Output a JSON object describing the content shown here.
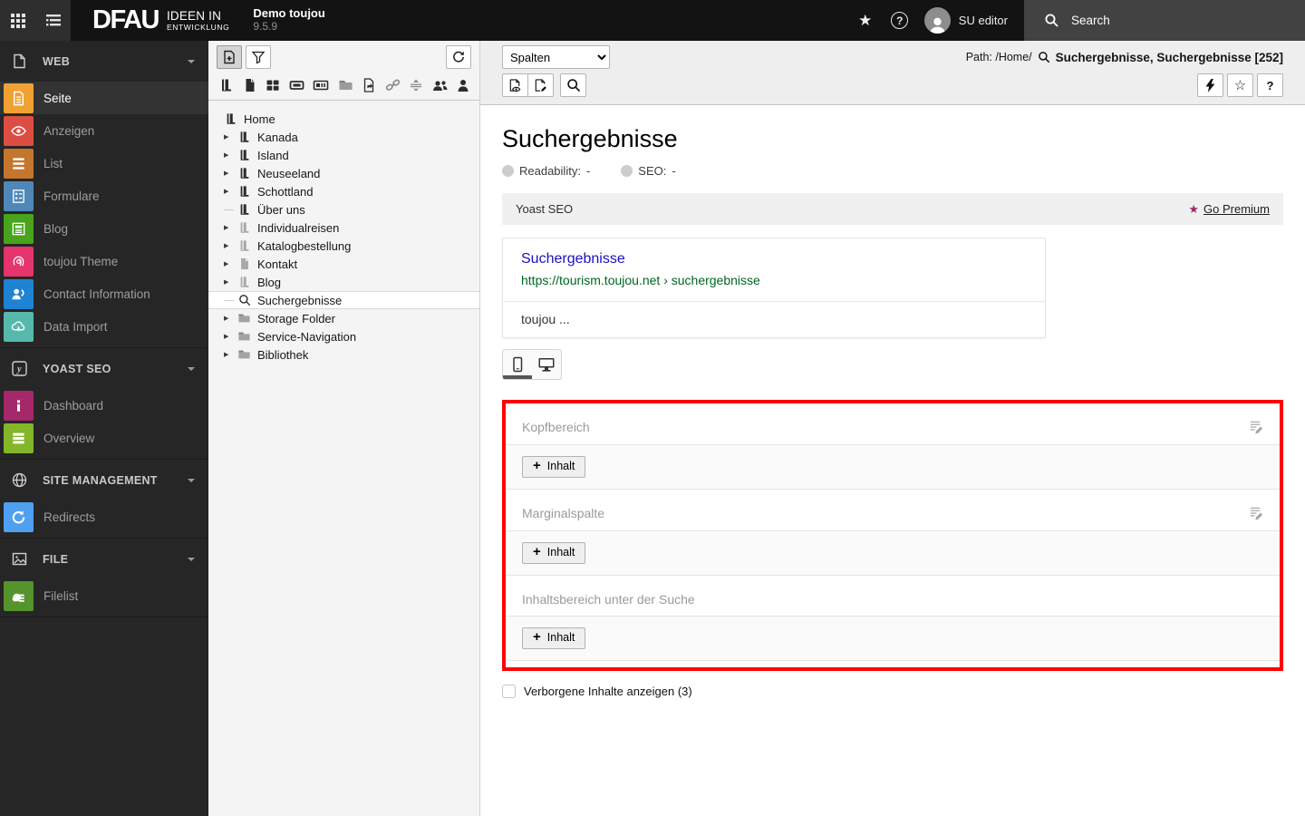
{
  "topbar": {
    "brand": "DFAU",
    "claim_line1": "IDEEN IN",
    "claim_line2": "ENTWICKLUNG",
    "site_name": "Demo toujou",
    "version": "9.5.9",
    "username": "SU editor",
    "search_label": "Search"
  },
  "module_menu": {
    "sections": [
      {
        "label": "WEB",
        "icon": "web-section-icon",
        "items": [
          {
            "label": "Seite",
            "icon": "page-icon",
            "color": "#f0a132"
          },
          {
            "label": "Anzeigen",
            "icon": "eye-icon",
            "color": "#dc4e41"
          },
          {
            "label": "List",
            "icon": "list-icon",
            "color": "#c4762c"
          },
          {
            "label": "Formulare",
            "icon": "form-icon",
            "color": "#4f87b8"
          },
          {
            "label": "Blog",
            "icon": "blog-icon",
            "color": "#48a41c"
          },
          {
            "label": "toujou Theme",
            "icon": "fingerprint-icon",
            "color": "#e5346c"
          },
          {
            "label": "Contact Information",
            "icon": "contact-icon",
            "color": "#1f83d3"
          },
          {
            "label": "Data Import",
            "icon": "cloud-import-icon",
            "color": "#57b9ac"
          }
        ]
      },
      {
        "label": "YOAST SEO",
        "icon": "yoast-section-icon",
        "items": [
          {
            "label": "Dashboard",
            "icon": "info-icon",
            "color": "#a4286a"
          },
          {
            "label": "Overview",
            "icon": "bars-icon",
            "color": "#84b62a"
          }
        ]
      },
      {
        "label": "SITE MANAGEMENT",
        "icon": "globe-section-icon",
        "items": [
          {
            "label": "Redirects",
            "icon": "redirect-icon",
            "color": "#4fa0f0"
          }
        ]
      },
      {
        "label": "FILE",
        "icon": "image-section-icon",
        "items": [
          {
            "label": "Filelist",
            "icon": "filelist-icon",
            "color": "#55932c"
          }
        ]
      }
    ]
  },
  "pagetree": {
    "items": [
      {
        "label": "Home",
        "icon": "page-door-icon"
      },
      {
        "label": "Kanada",
        "icon": "page-door-icon"
      },
      {
        "label": "Island",
        "icon": "page-door-icon"
      },
      {
        "label": "Neuseeland",
        "icon": "page-door-icon"
      },
      {
        "label": "Schottland",
        "icon": "page-door-icon"
      },
      {
        "label": "Über uns",
        "icon": "page-door-icon"
      },
      {
        "label": "Individualreisen",
        "icon": "page-door-muted-icon"
      },
      {
        "label": "Katalogbestellung",
        "icon": "page-door-muted-icon"
      },
      {
        "label": "Kontakt",
        "icon": "page-muted-icon"
      },
      {
        "label": "Blog",
        "icon": "page-door-muted-icon"
      },
      {
        "label": "Suchergebnisse",
        "icon": "search-page-icon",
        "selected": true
      },
      {
        "label": "Storage Folder",
        "icon": "folder-icon"
      },
      {
        "label": "Service-Navigation",
        "icon": "folder-icon"
      },
      {
        "label": "Bibliothek",
        "icon": "folder-icon"
      }
    ]
  },
  "docheader": {
    "columns_select": "Spalten",
    "path_label": "Path: /Home/",
    "record_title": "Suchergebnisse, Suchergebnisse [252]",
    "help_label": "?"
  },
  "content": {
    "title": "Suchergebnisse",
    "readability_label": "Readability:",
    "readability_value": "-",
    "seo_label": "SEO:",
    "seo_value": "-",
    "yoast": {
      "panel_title": "Yoast SEO",
      "premium_link": "Go Premium",
      "snippet": {
        "title": "Suchergebnisse",
        "url": "https://tourism.toujou.net › suchergebnisse",
        "description": "toujou ..."
      }
    },
    "sections": [
      {
        "label": "Kopfbereich",
        "button_label": "Inhalt"
      },
      {
        "label": "Marginalspalte",
        "button_label": "Inhalt"
      },
      {
        "label": "Inhaltsbereich unter der Suche",
        "button_label": "Inhalt"
      }
    ],
    "hidden_toggle_label": "Verborgene Inhalte anzeigen (3)"
  },
  "icons": {
    "tree_arrow": "▶",
    "star_filled": "★",
    "star_outline": "☆",
    "plus": "+"
  },
  "colors": {
    "accent_red": "#ff0000",
    "yoast_purple": "#a4286a",
    "snippet_title_blue": "#1e0fbe",
    "snippet_url_green": "#006621",
    "topbar_bg": "#141414",
    "module_menu_bg": "#262626",
    "docheader_bg": "#eeeeee"
  }
}
